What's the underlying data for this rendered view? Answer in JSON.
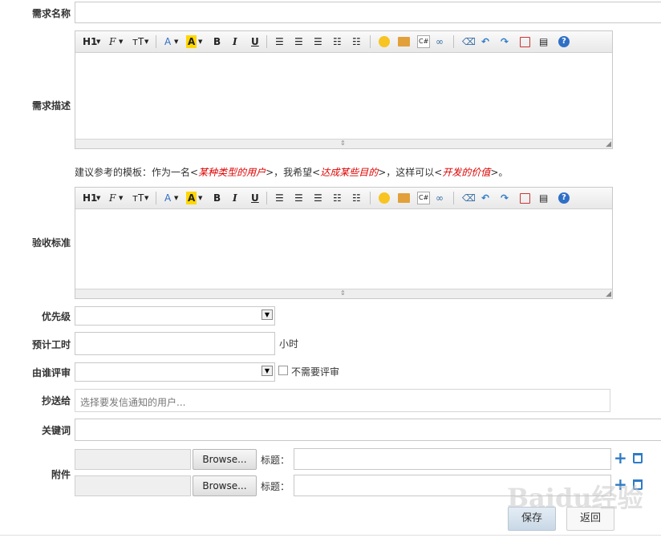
{
  "fields": {
    "name_label": "需求名称",
    "desc_label": "需求描述",
    "accept_label": "验收标准",
    "priority_label": "优先级",
    "estimate_label": "预计工时",
    "estimate_unit": "小时",
    "reviewer_label": "由谁评审",
    "no_review_label": "不需要评审",
    "cc_label": "抄送给",
    "cc_placeholder": "选择要发信通知的用户...",
    "keywords_label": "关键词",
    "attachment_label": "附件"
  },
  "toolbar": {
    "heading": "H1",
    "font": "F",
    "size": "тT",
    "forecolor": "A",
    "backcolor": "A",
    "bold": "B",
    "italic": "I",
    "underline": "U",
    "code": "C#"
  },
  "hint": {
    "prefix": "建议参考的模板：作为一名<",
    "role": "某种类型的用户",
    "mid1": ">，我希望<",
    "goal": "达成某些目的",
    "mid2": ">，这样可以<",
    "value": "开发的价值",
    "suffix": ">。"
  },
  "attachments": [
    {
      "browse": "Browse...",
      "title_label": "标题："
    },
    {
      "browse": "Browse...",
      "title_label": "标题："
    }
  ],
  "actions": {
    "save": "保存",
    "back": "返回"
  },
  "watermark": "Baidu经验",
  "colors": {
    "accent": "#2f7bc6",
    "hint_red": "#dd0000"
  }
}
